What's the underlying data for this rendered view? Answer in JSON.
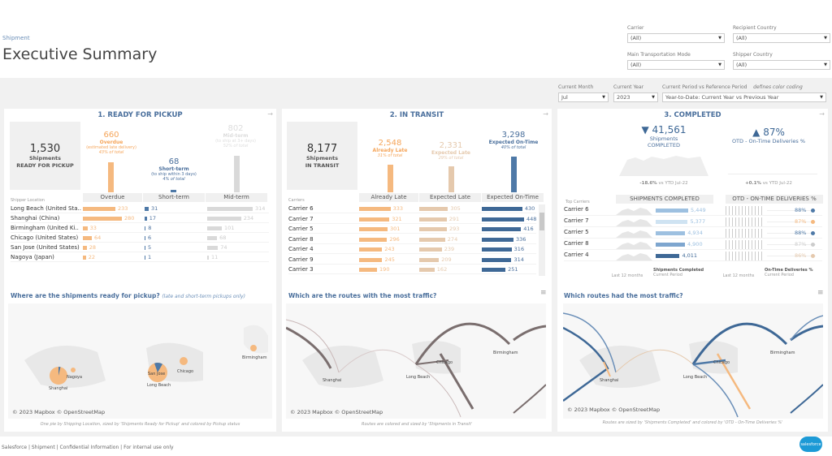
{
  "header": {
    "breadcrumb": "Shipment",
    "title": "Executive Summary"
  },
  "filters": {
    "carrier": {
      "label": "Carrier",
      "value": "(All)"
    },
    "recipient_country": {
      "label": "Recipient Country",
      "value": "(All)"
    },
    "main_transport_mode": {
      "label": "Main Transportation Mode",
      "value": "(All)"
    },
    "shipper_country": {
      "label": "Shipper Country",
      "value": "(All)"
    },
    "current_month": {
      "label": "Current Month",
      "value": "Jul"
    },
    "current_year": {
      "label": "Current Year",
      "value": "2023"
    },
    "period": {
      "label": "Current Period vs Reference Period",
      "hint": "defines color coding",
      "value": "Year-to-Date: Current Year vs Previous Year"
    }
  },
  "colors": {
    "late": "#f5b97f",
    "expected_late": "#e5c9ad",
    "ontime": "#4e79a7",
    "short": "#4e79a7",
    "mid": "#d9d9d9",
    "accent": "#4a6f9c"
  },
  "pickup": {
    "title": "1. READY FOR PICKUP",
    "total": "1,530",
    "total_l1": "Shipments",
    "total_l2": "READY FOR PICKUP",
    "overdue": {
      "value": "660",
      "label": "Overdue",
      "desc": "(estimated late delivery)",
      "pct": "43% of total",
      "share": 0.43
    },
    "short": {
      "value": "68",
      "label": "Short-term",
      "desc": "(to ship within 3 days)",
      "pct": "4% of total",
      "share": 0.04
    },
    "mid": {
      "value": "802",
      "label": "Mid-term",
      "desc": "(to ship at 3+ days)",
      "pct": "52% of total",
      "share": 0.52
    },
    "row_header": "Shipper Location",
    "columns": [
      "Overdue",
      "Short-term",
      "Mid-term"
    ],
    "rows": [
      {
        "name": "Long Beach (United Sta..",
        "overdue": 233,
        "short": 31,
        "mid": 314
      },
      {
        "name": "Shanghai (China)",
        "overdue": 280,
        "short": 17,
        "mid": 234
      },
      {
        "name": "Birmingham (United Ki..",
        "overdue": 33,
        "short": 8,
        "mid": 101
      },
      {
        "name": "Chicago (United States)",
        "overdue": 64,
        "short": 6,
        "mid": 68
      },
      {
        "name": "San Jose (United States)",
        "overdue": 28,
        "short": 5,
        "mid": 74
      },
      {
        "name": "Nagoya (Japan)",
        "overdue": 22,
        "short": 1,
        "mid": 11
      }
    ],
    "map_title": "Where are the shipments ready for pickup?",
    "map_subtitle": "(late and short-term pickups only)",
    "map_cities": [
      "Shanghai",
      "Nagoya",
      "San Jose",
      "Long Beach",
      "Chicago",
      "Birmingham"
    ],
    "copyright": "© 2023 Mapbox © OpenStreetMap",
    "note": "One pie by Shipping Location, sized by 'Shipments Ready for Pickup' and colored by Pickup status"
  },
  "transit": {
    "title": "2. IN TRANSIT",
    "total": "8,177",
    "total_l1": "Shipments",
    "total_l2": "IN TRANSIT",
    "late": {
      "value": "2,548",
      "label": "Already Late",
      "pct": "31% of total",
      "share": 0.31
    },
    "exp_late": {
      "value": "2,331",
      "label": "Expected Late",
      "pct": "29% of total",
      "share": 0.29
    },
    "ontime": {
      "value": "3,298",
      "label": "Expected On-Time",
      "pct": "40% of total",
      "share": 0.4
    },
    "row_header": "Carriers",
    "columns": [
      "Already Late",
      "Expected Late",
      "Expected On-Time"
    ],
    "rows": [
      {
        "name": "Carrier 6",
        "late": 333,
        "exp": 305,
        "on": 430
      },
      {
        "name": "Carrier 7",
        "late": 321,
        "exp": 291,
        "on": 448
      },
      {
        "name": "Carrier 5",
        "late": 301,
        "exp": 293,
        "on": 416
      },
      {
        "name": "Carrier 8",
        "late": 296,
        "exp": 274,
        "on": 336
      },
      {
        "name": "Carrier 4",
        "late": 243,
        "exp": 239,
        "on": 316
      },
      {
        "name": "Carrier 9",
        "late": 245,
        "exp": 209,
        "on": 314
      },
      {
        "name": "Carrier 3",
        "late": 190,
        "exp": 162,
        "on": 251
      }
    ],
    "map_title": "Which are the routes with the most traffic?",
    "map_cities": [
      "Shanghai",
      "Long Beach",
      "Chicago",
      "Birmingham"
    ],
    "copyright": "© 2023 Mapbox © OpenStreetMap",
    "note": "Routes are colored and sized by 'Shipments in Transit'"
  },
  "completed": {
    "title": "3. COMPLETED",
    "shipments": {
      "value": "41,561",
      "arrow": "▼",
      "l1": "Shipments",
      "l2": "COMPLETED",
      "delta": "-18.6%",
      "vs": "vs YTD Jul-22"
    },
    "otd": {
      "value": "87%",
      "arrow": "▲",
      "l1": "OTD - On-Time Deliveries %",
      "delta": "+0.1%",
      "vs": "vs YTD Jul-22"
    },
    "row_header": "Top Carriers",
    "columns": [
      "SHIPMENTS COMPLETED",
      "OTD - ON-TIME DELIVERIES %"
    ],
    "rows": [
      {
        "name": "Carrier 6",
        "ship": "5,449",
        "ship_n": 5449,
        "otd": "88%",
        "otd_color": "#4e79a7",
        "bar": "#9dc0e0"
      },
      {
        "name": "Carrier 7",
        "ship": "5,377",
        "ship_n": 5377,
        "otd": "87%",
        "otd_color": "#f5b97f",
        "bar": "#cfe3f2"
      },
      {
        "name": "Carrier 5",
        "ship": "4,934",
        "ship_n": 4934,
        "otd": "88%",
        "otd_color": "#4e79a7",
        "bar": "#9dc0e0"
      },
      {
        "name": "Carrier 8",
        "ship": "4,900",
        "ship_n": 4900,
        "otd": "87%",
        "otd_color": "#cccccc",
        "bar": "#7ea6cf"
      },
      {
        "name": "Carrier 4",
        "ship": "4,011",
        "ship_n": 4011,
        "otd": "86%",
        "otd_color": "#e5c9ad",
        "bar": "#3e6896"
      }
    ],
    "foot_last12": "Last 12 months",
    "foot_ship": "Shipments Completed",
    "foot_otd": "On-Time Deliveries %",
    "foot_current": "Current Period",
    "map_title": "Which routes had the most traffic?",
    "map_cities": [
      "Shanghai",
      "Long Beach",
      "Chicago",
      "Birmingham"
    ],
    "copyright": "© 2023 Mapbox © OpenStreetMap",
    "note": "Routes are sized by 'Shipments Completed' and colored by 'OTD - On-Time Deliveries %'"
  },
  "footer": {
    "text": "Salesforce | Shipment | Confidential Information | For internal use only",
    "logo": "salesforce"
  }
}
